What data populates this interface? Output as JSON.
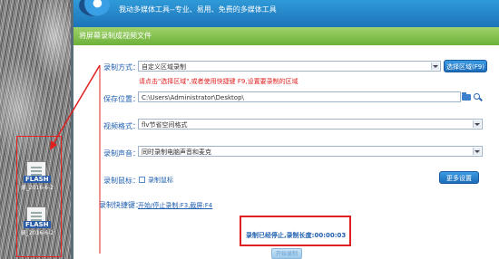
{
  "header": {
    "slogan": "我动多媒体工具--专业、易用、免费的多媒体工具"
  },
  "section_title": "将屏幕录制成视频文件",
  "form": {
    "mode_label": "录制方式：",
    "mode_value": "自定义区域录制",
    "select_area_button": "选择区域(F9)",
    "hint": "请点击\"选择区域\",或者使用快捷键 F9,设置要录制的区域",
    "save_label": "保存位置：",
    "save_path": "C:\\Users\\Administrator\\Desktop\\",
    "format_label": "视频格式：",
    "format_value": "flv节省空间格式",
    "audio_label": "录制声音：",
    "audio_value": "同时录制电脑声音和麦克",
    "cursor_label": "录制鼠标：",
    "cursor_checkbox_label": "录制鼠标",
    "more_settings_button": "更多设置",
    "hotkey_label": "录制快捷键：",
    "hotkey_value": "开始/停止录制:F3,截屏:F4"
  },
  "status_text": "录制已经停止,录制长度:00:00:03",
  "start_button": "开始录制",
  "desktop_icons": [
    {
      "badge": "FLASH",
      "label": "录_2016-6-2"
    },
    {
      "badge": "FLASH",
      "label": "录_2016-6-2"
    }
  ],
  "colors": {
    "accent_blue": "#1d74b8",
    "green_bar": "#7dbd45",
    "highlight_red": "#e02020"
  }
}
